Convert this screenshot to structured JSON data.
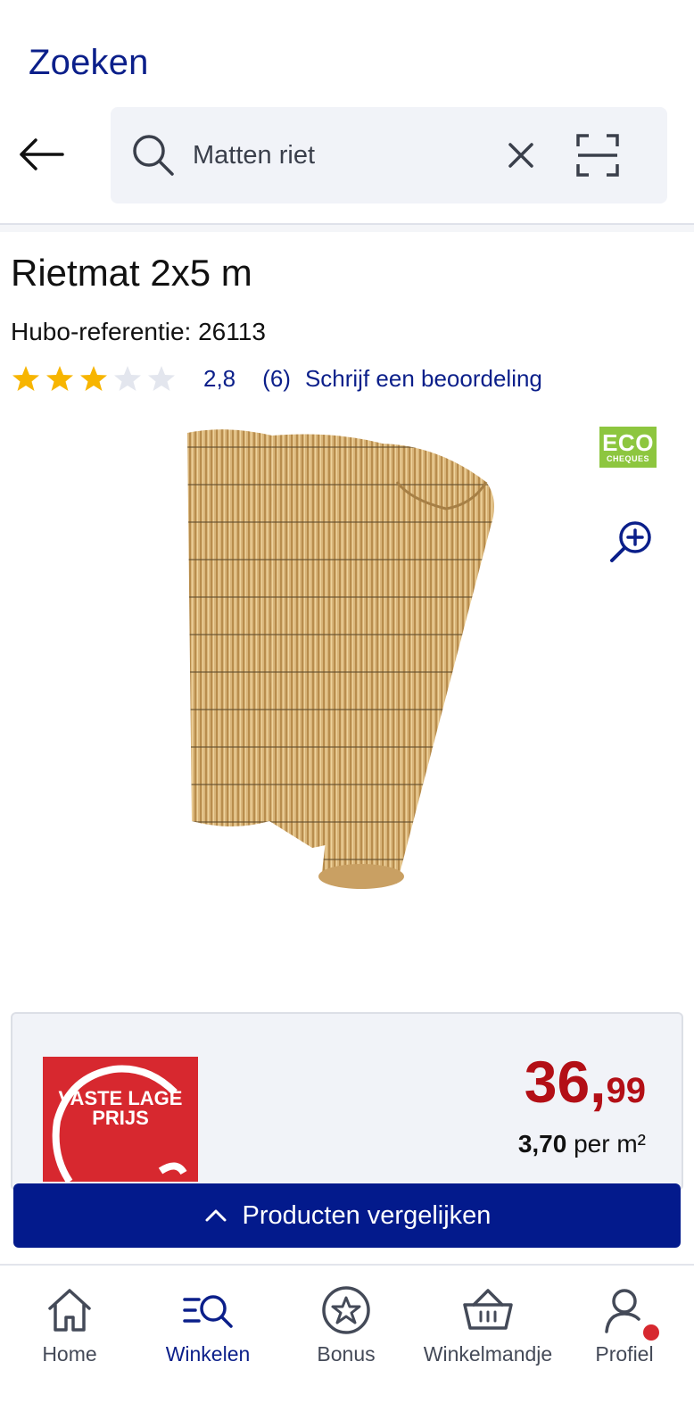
{
  "header": {
    "title": "Zoeken"
  },
  "search": {
    "value": "Matten riet",
    "placeholder": "Zoeken"
  },
  "product": {
    "title": "Rietmat 2x5 m",
    "reference_label": "Hubo-referentie: ",
    "reference_value": "26113",
    "rating": 2.8,
    "rating_display": "2,8",
    "rating_max": 5,
    "review_count": "(6)",
    "review_link": "Schrijf een beoordeling",
    "eco_badge": {
      "big": "ECO",
      "small": "CHEQUES"
    }
  },
  "price": {
    "badge_line1": "VASTE LAGE",
    "badge_line2": "PRIJS",
    "integer": "36,",
    "decimal": "99",
    "unit_value": "3,70",
    "unit_label": " per m²"
  },
  "compare": {
    "label": "Producten vergelijken"
  },
  "bottom_nav": [
    {
      "label": "Home",
      "icon": "home-icon"
    },
    {
      "label": "Winkelen",
      "icon": "shop-search-icon",
      "active": true
    },
    {
      "label": "Bonus",
      "icon": "bonus-star-icon"
    },
    {
      "label": "Winkelmandje",
      "icon": "basket-icon"
    },
    {
      "label": "Profiel",
      "icon": "profile-icon",
      "notification": true
    }
  ],
  "colors": {
    "brand_blue": "#0b1f8a",
    "compare_bar": "#031a8c",
    "price_red": "#b30f16",
    "star": "#f7b500",
    "star_empty": "#e3e6ee",
    "eco_green": "#8dc63f",
    "badge_red": "#d7282f"
  }
}
